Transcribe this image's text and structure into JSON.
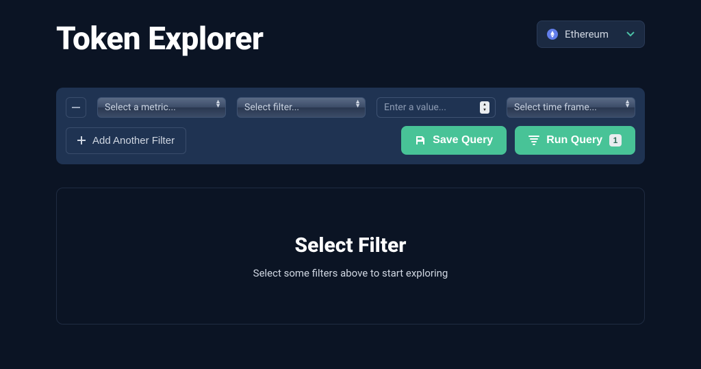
{
  "header": {
    "title": "Token Explorer"
  },
  "network": {
    "selected": "Ethereum"
  },
  "filters": {
    "metric_placeholder": "Select a metric...",
    "filter_placeholder": "Select filter...",
    "value_placeholder": "Enter a value...",
    "timeframe_placeholder": "Select time frame..."
  },
  "actions": {
    "add_filter_label": "Add Another Filter",
    "save_query_label": "Save Query",
    "run_query_label": "Run Query",
    "run_badge": "1"
  },
  "empty_state": {
    "title": "Select Filter",
    "subtitle": "Select some filters above to start exploring"
  }
}
